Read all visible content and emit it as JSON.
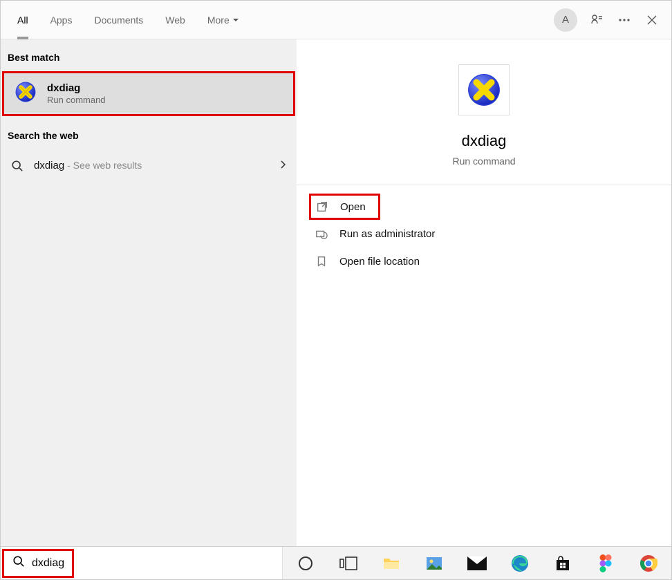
{
  "header": {
    "tabs": [
      "All",
      "Apps",
      "Documents",
      "Web",
      "More"
    ],
    "avatar_letter": "A"
  },
  "left": {
    "best_match_label": "Best match",
    "result_title": "dxdiag",
    "result_subtitle": "Run command",
    "search_web_label": "Search the web",
    "web_term": "dxdiag",
    "web_suffix": " - See web results"
  },
  "preview": {
    "title": "dxdiag",
    "subtitle": "Run command",
    "actions": {
      "open": "Open",
      "run_admin": "Run as administrator",
      "open_location": "Open file location"
    }
  },
  "taskbar": {
    "search_value": "dxdiag",
    "icons": [
      "cortana-icon",
      "taskview-icon",
      "file-explorer-icon",
      "photos-icon",
      "mail-icon",
      "edge-icon",
      "store-icon",
      "figma-icon",
      "chrome-icon"
    ]
  }
}
